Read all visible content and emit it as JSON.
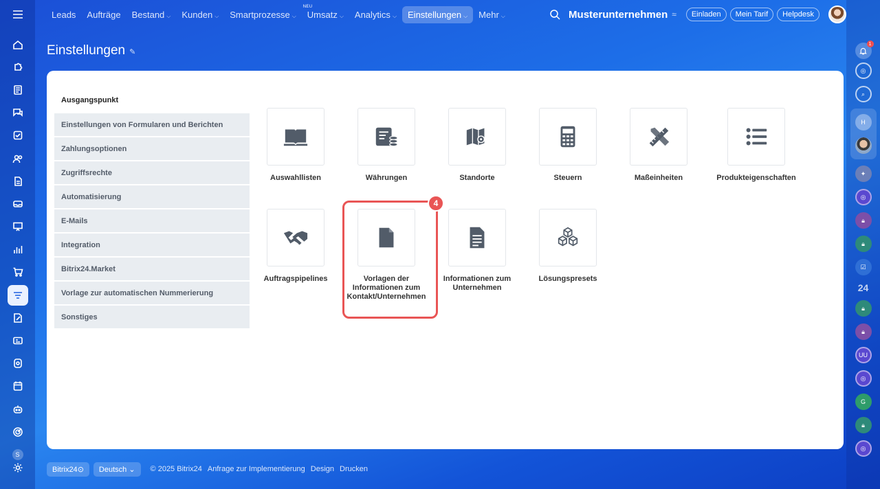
{
  "nav": {
    "items": [
      {
        "label": "Leads",
        "chevron": false
      },
      {
        "label": "Aufträge",
        "chevron": false
      },
      {
        "label": "Bestand",
        "chevron": true
      },
      {
        "label": "Kunden",
        "chevron": true
      },
      {
        "label": "Smartprozesse",
        "chevron": true
      },
      {
        "label": "Umsatz",
        "chevron": true,
        "badge": "NEU"
      },
      {
        "label": "Analytics",
        "chevron": true
      },
      {
        "label": "Einstellungen",
        "chevron": true,
        "active": true
      },
      {
        "label": "Mehr",
        "chevron": true
      }
    ]
  },
  "header": {
    "company": "Musterunternehmen",
    "invite": "Einladen",
    "plan": "Mein Tarif",
    "helpdesk": "Helpdesk"
  },
  "page": {
    "title": "Einstellungen"
  },
  "menu": {
    "heading": "Ausgangspunkt",
    "items": [
      "Einstellungen von Formularen und Berichten",
      "Zahlungsoptionen",
      "Zugriffsrechte",
      "Automatisierung",
      "E-Mails",
      "Integration",
      "Bitrix24.Market",
      "Vorlage zur automatischen Nummerierung",
      "Sonstiges"
    ]
  },
  "tiles": [
    {
      "label": "Auswahllisten",
      "icon": "book-icon"
    },
    {
      "label": "Währungen",
      "icon": "currency-icon"
    },
    {
      "label": "Standorte",
      "icon": "map-icon"
    },
    {
      "label": "Steuern",
      "icon": "calculator-icon"
    },
    {
      "label": "Maßeinheiten",
      "icon": "ruler-pencil-icon"
    },
    {
      "label": "Produkteigenschaften",
      "icon": "list-icon"
    },
    {
      "label": "Auftragspipelines",
      "icon": "handshake-icon"
    },
    {
      "label": "Vorlagen der Informationen zum Kontakt/Unternehmen",
      "icon": "file-icon"
    },
    {
      "label": "Informationen zum Unternehmen",
      "icon": "document-icon"
    },
    {
      "label": "Lösungspresets",
      "icon": "cubes-icon"
    }
  ],
  "step_badge": "4",
  "right_bar": {
    "counter": "24",
    "avatar_letters": [
      "H",
      "UU",
      "G"
    ]
  },
  "left_bar": {
    "user_badge": "S"
  },
  "footer": {
    "brand": "Bitrix24",
    "language": "Deutsch",
    "copyright": "© 2025 Bitrix24",
    "links": [
      "Anfrage zur Implementierung",
      "Design",
      "Drucken"
    ]
  },
  "colors": {
    "accent": "#2a6fe6",
    "highlight": "#e95555",
    "tile_icon": "#525c69"
  }
}
